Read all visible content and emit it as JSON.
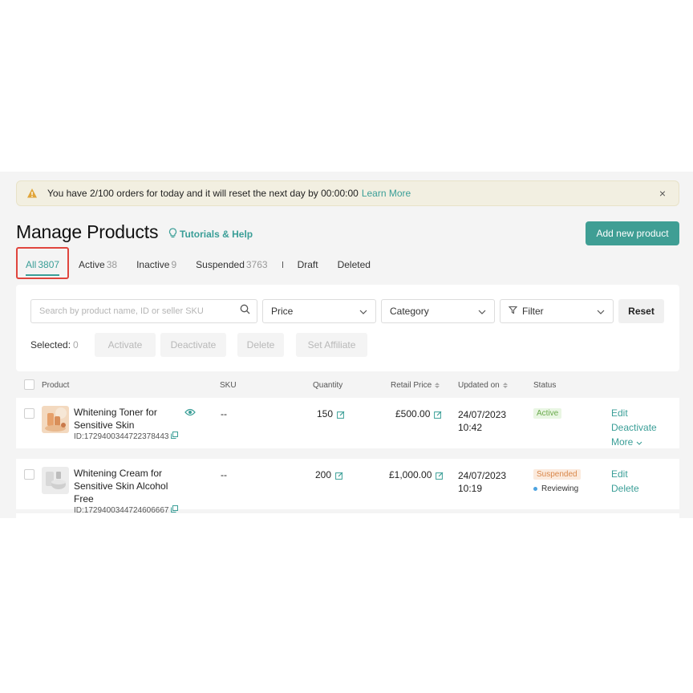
{
  "notice": {
    "text": "You have 2/100 orders for today and it will reset the next day by 00:00:00",
    "link": "Learn More",
    "close": "×"
  },
  "header": {
    "title": "Manage Products",
    "tutorials": "Tutorials & Help",
    "add_button": "Add new product"
  },
  "tabs": [
    {
      "label": "All",
      "count": "3807"
    },
    {
      "label": "Active",
      "count": "38"
    },
    {
      "label": "Inactive",
      "count": "9"
    },
    {
      "label": "Suspended",
      "count": "3763"
    },
    {
      "label": "Draft",
      "count": ""
    },
    {
      "label": "Deleted",
      "count": ""
    }
  ],
  "filters": {
    "search_placeholder": "Search by product name, ID or seller SKU",
    "price": "Price",
    "category": "Category",
    "filter": "Filter",
    "reset": "Reset",
    "selected_label": "Selected:",
    "selected_count": "0",
    "bulk": {
      "activate": "Activate",
      "deactivate": "Deactivate",
      "delete": "Delete",
      "set_affiliate": "Set Affiliate"
    }
  },
  "table": {
    "columns": {
      "product": "Product",
      "sku": "SKU",
      "quantity": "Quantity",
      "retail_price": "Retail Price",
      "updated_on": "Updated on",
      "status": "Status"
    },
    "rows": [
      {
        "name": "Whitening Toner for Sensitive Skin",
        "id": "ID:1729400344722378443",
        "sku": "--",
        "quantity": "150",
        "price": "£500.00",
        "date": "24/07/2023",
        "time": "10:42",
        "status": "Active",
        "substatus": "",
        "actions": {
          "a1": "Edit",
          "a2": "Deactivate",
          "a3": "More"
        }
      },
      {
        "name": "Whitening Cream for Sensitive Skin Alcohol Free",
        "id": "ID:1729400344724606667",
        "sku": "--",
        "quantity": "200",
        "price": "£1,000.00",
        "date": "24/07/2023",
        "time": "10:19",
        "status": "Suspended",
        "substatus": "Reviewing",
        "actions": {
          "a1": "Edit",
          "a2": "Delete"
        }
      }
    ]
  },
  "colors": {
    "accent": "#3a9e97",
    "button": "#3f9e94",
    "highlight": "#e0453d",
    "active_badge": "#6aaa4c",
    "suspended_badge": "#d9874a"
  }
}
